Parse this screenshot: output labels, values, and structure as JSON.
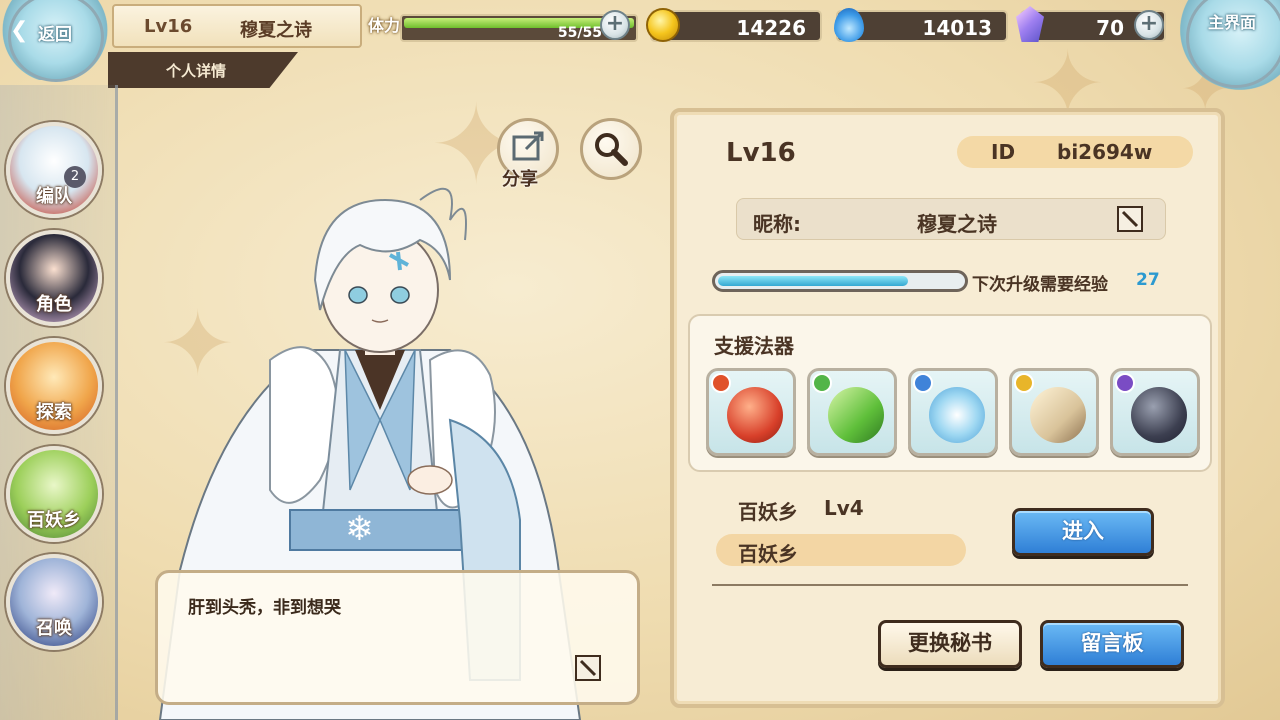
{
  "top_bar": {
    "back_label": "返回",
    "level": "Lv16",
    "player_name": "穆夏之诗",
    "sub_tab": "个人详情",
    "stamina_label": "体力",
    "stamina_value": "55/55",
    "stamina_fraction": 1.0,
    "gold": "14226",
    "soul_jade": "14013",
    "crystal": "70",
    "home_label": "主界面"
  },
  "nav": {
    "items": [
      {
        "label": "编队",
        "badge": "2"
      },
      {
        "label": "角色"
      },
      {
        "label": "探索"
      },
      {
        "label": "百妖乡"
      },
      {
        "label": "召唤"
      }
    ]
  },
  "character": {
    "share_label": "分享",
    "speech": "肝到头秃，非到想哭"
  },
  "panel": {
    "level": "Lv16",
    "id_key": "ID",
    "id_value": "bi2694w",
    "nickname_key": "昵称:",
    "nickname_value": "穆夏之诗",
    "exp_fraction": 0.78,
    "exp_label": "下次升级需要经验",
    "exp_value": "27",
    "support_title": "支援法器",
    "relics": [
      {
        "name": "red-orb-relic",
        "gem": "#e0522a"
      },
      {
        "name": "green-leaf-relic",
        "gem": "#53b548"
      },
      {
        "name": "blue-snowflake-relic",
        "gem": "#3f83d9"
      },
      {
        "name": "gold-crate-relic",
        "gem": "#e8b52a"
      },
      {
        "name": "purple-chain-relic",
        "gem": "#7a4cc4"
      }
    ],
    "village_name": "百妖乡",
    "village_level": "Lv4",
    "village_pill": "百妖乡",
    "enter_button": "进入",
    "change_secretary_button": "更换秘书",
    "message_board_button": "留言板"
  }
}
